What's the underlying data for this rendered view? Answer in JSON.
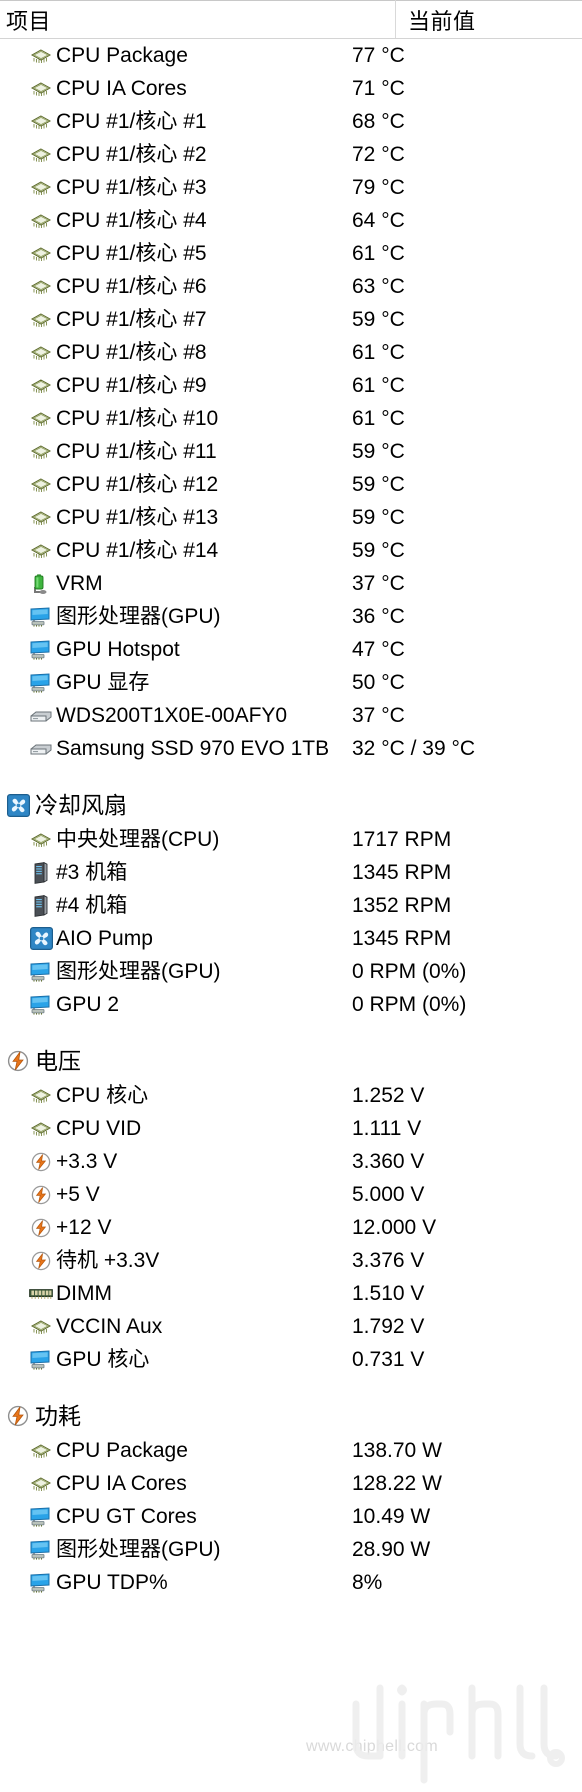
{
  "header": {
    "item_column": "项目",
    "value_column": "当前值"
  },
  "watermark": {
    "url_text": "www.chiphell.com",
    "logo_text": "chiphell"
  },
  "sections": [
    {
      "id": "temperatures",
      "title": null,
      "icon": null,
      "rows": [
        {
          "icon": "cpu-chip-icon",
          "label": "CPU Package",
          "value": "77 °C"
        },
        {
          "icon": "cpu-chip-icon",
          "label": "CPU IA Cores",
          "value": "71 °C"
        },
        {
          "icon": "cpu-chip-icon",
          "label": "CPU #1/核心 #1",
          "value": "68 °C"
        },
        {
          "icon": "cpu-chip-icon",
          "label": "CPU #1/核心 #2",
          "value": "72 °C"
        },
        {
          "icon": "cpu-chip-icon",
          "label": "CPU #1/核心 #3",
          "value": "79 °C"
        },
        {
          "icon": "cpu-chip-icon",
          "label": "CPU #1/核心 #4",
          "value": "64 °C"
        },
        {
          "icon": "cpu-chip-icon",
          "label": "CPU #1/核心 #5",
          "value": "61 °C"
        },
        {
          "icon": "cpu-chip-icon",
          "label": "CPU #1/核心 #6",
          "value": "63 °C"
        },
        {
          "icon": "cpu-chip-icon",
          "label": "CPU #1/核心 #7",
          "value": "59 °C"
        },
        {
          "icon": "cpu-chip-icon",
          "label": "CPU #1/核心 #8",
          "value": "61 °C"
        },
        {
          "icon": "cpu-chip-icon",
          "label": "CPU #1/核心 #9",
          "value": "61 °C"
        },
        {
          "icon": "cpu-chip-icon",
          "label": "CPU #1/核心 #10",
          "value": "61 °C"
        },
        {
          "icon": "cpu-chip-icon",
          "label": "CPU #1/核心 #11",
          "value": "59 °C"
        },
        {
          "icon": "cpu-chip-icon",
          "label": "CPU #1/核心 #12",
          "value": "59 °C"
        },
        {
          "icon": "cpu-chip-icon",
          "label": "CPU #1/核心 #13",
          "value": "59 °C"
        },
        {
          "icon": "cpu-chip-icon",
          "label": "CPU #1/核心 #14",
          "value": "59 °C"
        },
        {
          "icon": "vrm-battery-icon",
          "label": "VRM",
          "value": "37 °C"
        },
        {
          "icon": "gpu-monitor-icon",
          "label": "图形处理器(GPU)",
          "value": "36 °C"
        },
        {
          "icon": "gpu-monitor-icon",
          "label": "GPU Hotspot",
          "value": "47 °C"
        },
        {
          "icon": "gpu-monitor-icon",
          "label": "GPU 显存",
          "value": "50 °C"
        },
        {
          "icon": "drive-icon",
          "label": "WDS200T1X0E-00AFY0",
          "value": "37 °C"
        },
        {
          "icon": "drive-icon",
          "label": "Samsung SSD 970 EVO 1TB",
          "value": "32 °C / 39 °C"
        }
      ]
    },
    {
      "id": "cooling-fans",
      "title": "冷却风扇",
      "icon": "fan-icon",
      "rows": [
        {
          "icon": "cpu-chip-icon",
          "label": "中央处理器(CPU)",
          "value": "1717 RPM"
        },
        {
          "icon": "case-tower-icon",
          "label": "#3 机箱",
          "value": "1345 RPM"
        },
        {
          "icon": "case-tower-icon",
          "label": "#4 机箱",
          "value": "1352 RPM"
        },
        {
          "icon": "fan-icon",
          "label": "AIO Pump",
          "value": "1345 RPM"
        },
        {
          "icon": "gpu-monitor-icon",
          "label": "图形处理器(GPU)",
          "value": "0 RPM  (0%)"
        },
        {
          "icon": "gpu-monitor-icon",
          "label": "GPU 2",
          "value": "0 RPM  (0%)"
        }
      ]
    },
    {
      "id": "voltages",
      "title": "电压",
      "icon": "bolt-icon",
      "rows": [
        {
          "icon": "cpu-chip-icon",
          "label": "CPU 核心",
          "value": "1.252 V"
        },
        {
          "icon": "cpu-chip-icon",
          "label": "CPU VID",
          "value": "1.111 V"
        },
        {
          "icon": "bolt-circle-icon",
          "label": "+3.3 V",
          "value": "3.360 V"
        },
        {
          "icon": "bolt-circle-icon",
          "label": "+5 V",
          "value": "5.000 V"
        },
        {
          "icon": "bolt-circle-icon",
          "label": "+12 V",
          "value": "12.000 V"
        },
        {
          "icon": "bolt-circle-icon",
          "label": "待机 +3.3V",
          "value": "3.376 V"
        },
        {
          "icon": "dimm-icon",
          "label": "DIMM",
          "value": "1.510 V"
        },
        {
          "icon": "cpu-chip-icon",
          "label": "VCCIN Aux",
          "value": "1.792 V"
        },
        {
          "icon": "gpu-monitor-icon",
          "label": "GPU 核心",
          "value": "0.731 V"
        }
      ]
    },
    {
      "id": "power",
      "title": "功耗",
      "icon": "bolt-icon",
      "rows": [
        {
          "icon": "cpu-chip-icon",
          "label": "CPU Package",
          "value": "138.70 W"
        },
        {
          "icon": "cpu-chip-icon",
          "label": "CPU IA Cores",
          "value": "128.22 W"
        },
        {
          "icon": "gpu-monitor-icon",
          "label": "CPU GT Cores",
          "value": "10.49 W"
        },
        {
          "icon": "gpu-monitor-icon",
          "label": "图形处理器(GPU)",
          "value": "28.90 W"
        },
        {
          "icon": "gpu-monitor-icon",
          "label": "GPU TDP%",
          "value": "8%"
        }
      ]
    }
  ]
}
